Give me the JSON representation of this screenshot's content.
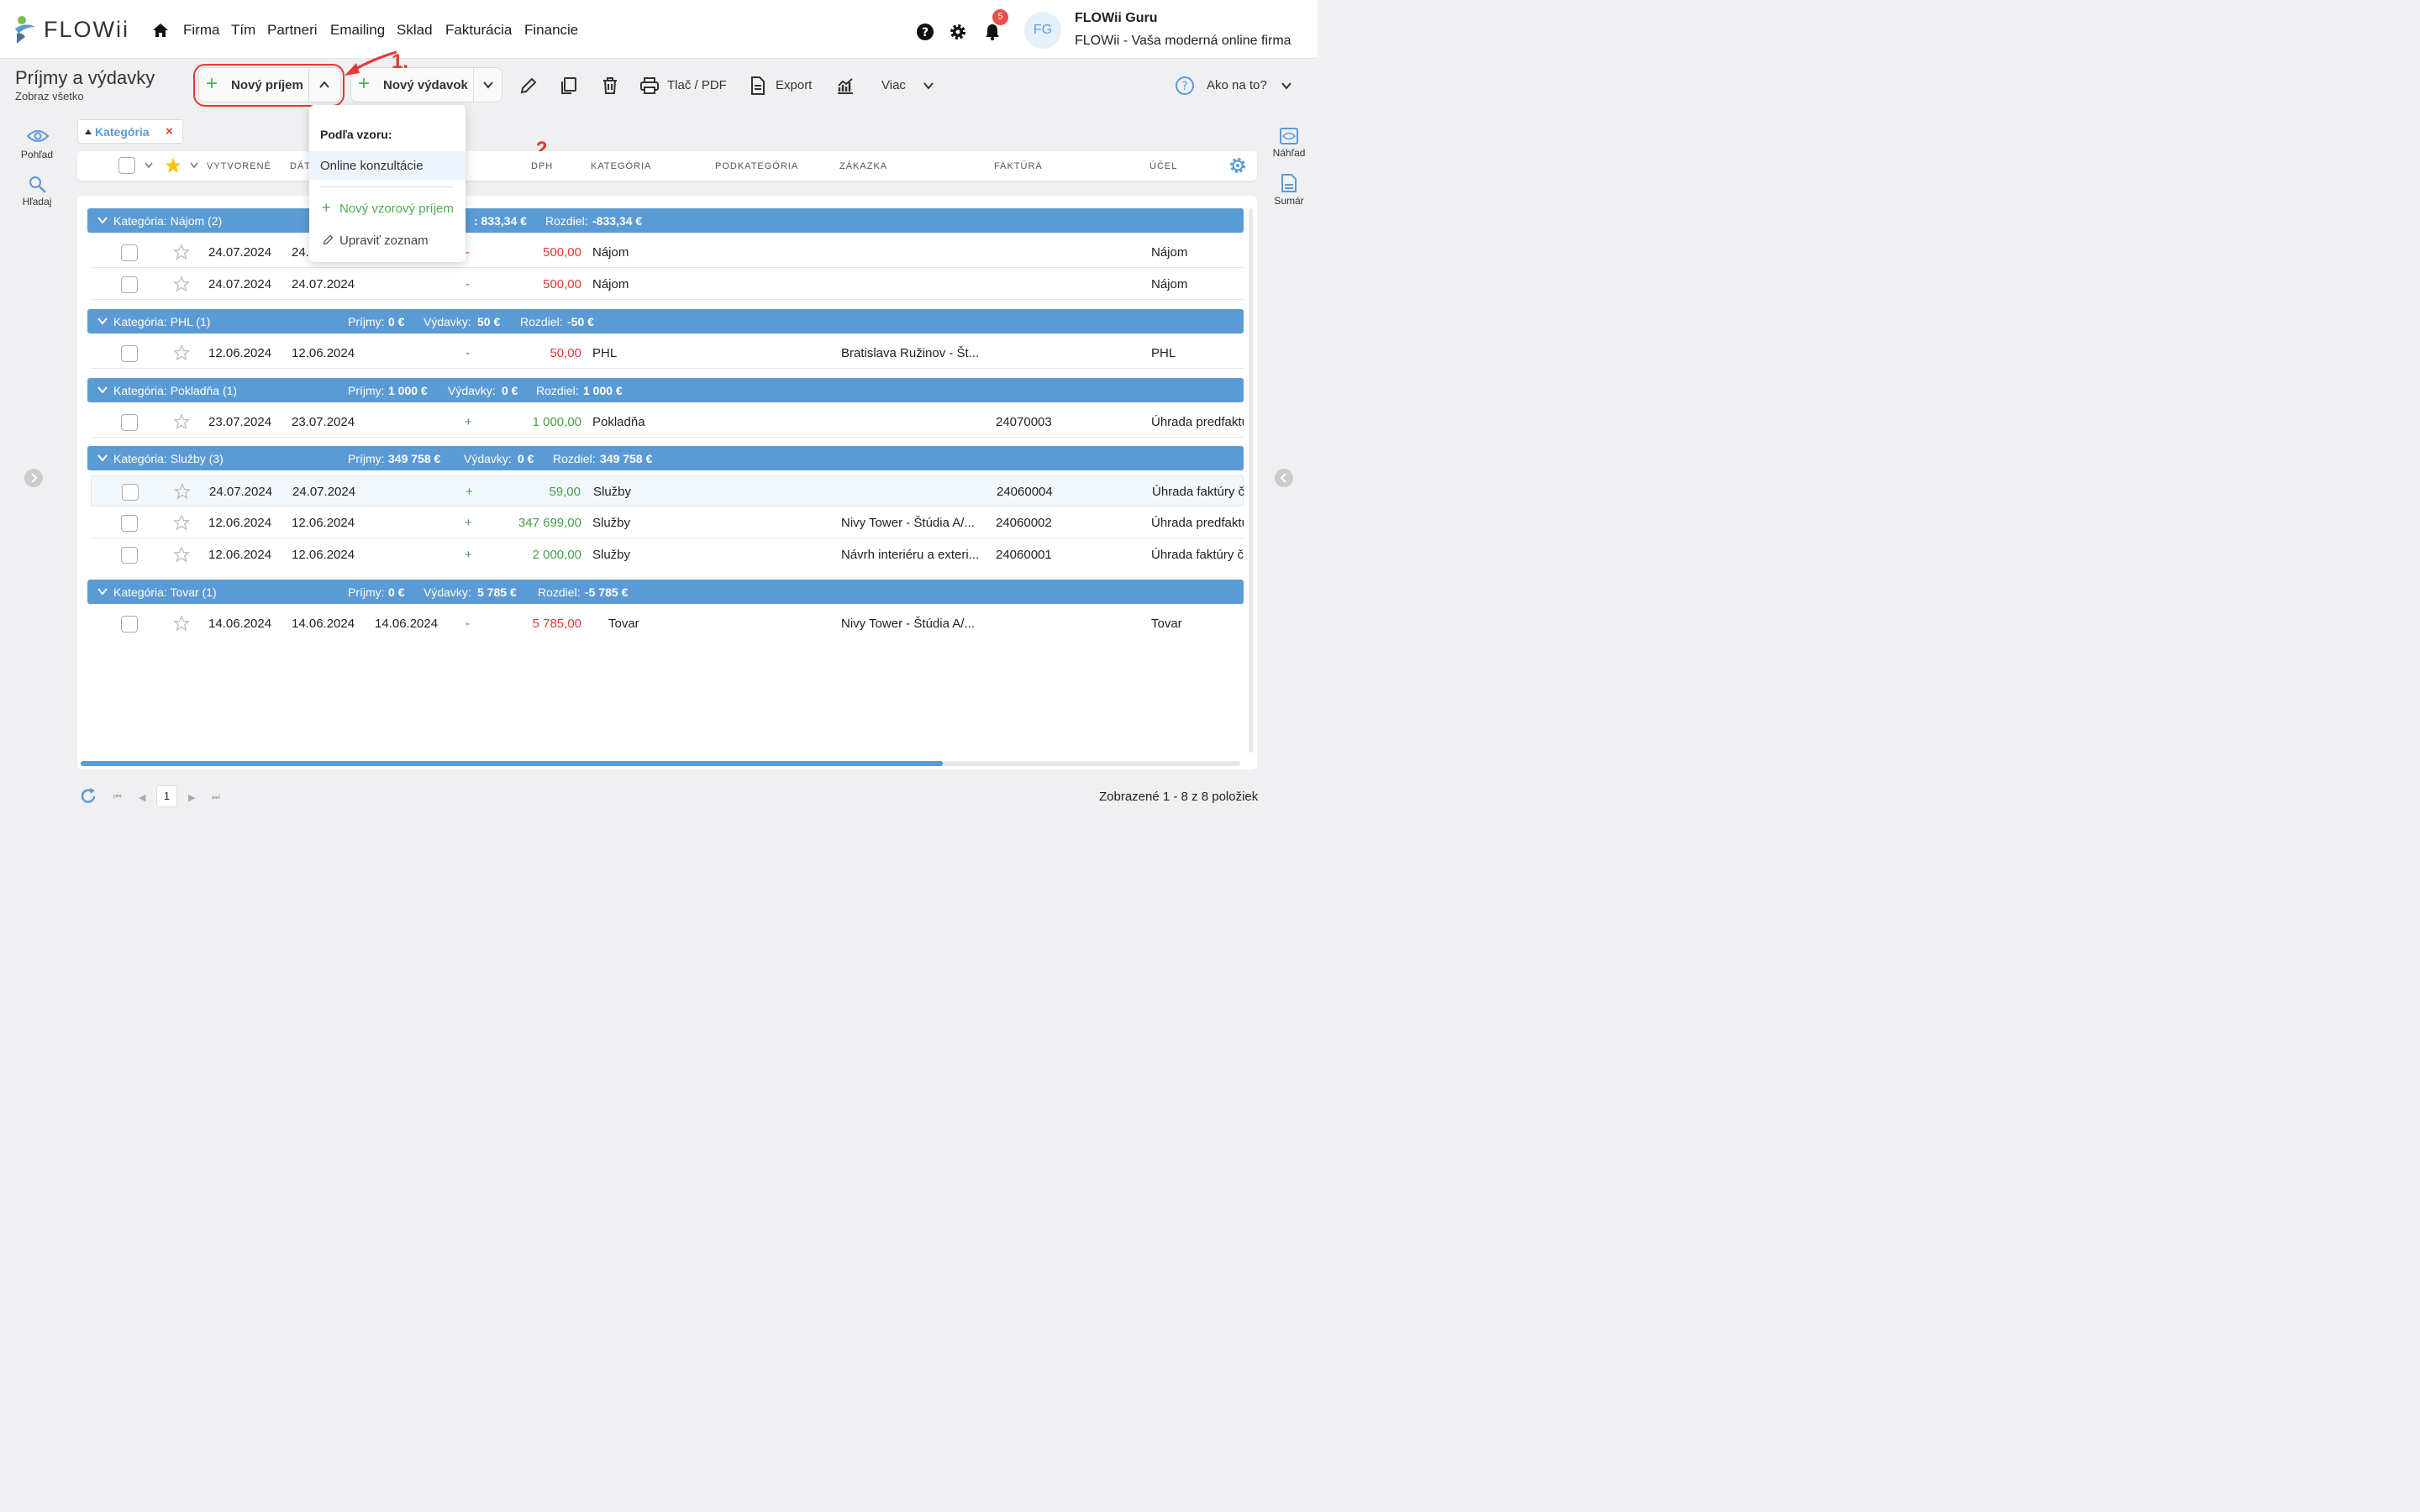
{
  "brand": {
    "name": "FLOWii"
  },
  "nav": [
    "Firma",
    "Tím",
    "Partneri",
    "Emailing",
    "Sklad",
    "Fakturácia",
    "Financie"
  ],
  "header": {
    "notifications": "5",
    "avatar": "FG",
    "user_name": "FLOWii Guru",
    "user_firm": "FLOWii - Vaša moderná online firma"
  },
  "page": {
    "title": "Príjmy a výdavky",
    "subtitle": "Zobraz všetko"
  },
  "toolbar": {
    "new_income": "Nový príjem",
    "new_expense": "Nový výdavok",
    "print": "Tlač / PDF",
    "export": "Export",
    "more": "Viac",
    "help": "Ako na to?"
  },
  "annotations": {
    "step1": "1.",
    "step2": "2."
  },
  "left_side": {
    "view": "Pohľad",
    "search": "Hľadaj"
  },
  "right_side": {
    "preview": "Náhľad",
    "summary": "Sumár"
  },
  "filter_chip": {
    "label": "Kategória",
    "remove": "×"
  },
  "columns": {
    "created": "VYTVORENÉ",
    "date": "DÁT",
    "dph": "DPH",
    "category": "KATEGÓRIA",
    "subcategory": "PODKATEGÓRIA",
    "order": "ZÁKAZKA",
    "invoice": "FAKTÚRA",
    "purpose": "ÚČEL"
  },
  "dropdown": {
    "heading": "Podľa vzoru:",
    "item": "Online konzultácie",
    "new_template": "Nový vzorový príjem",
    "edit_list": "Upraviť zoznam"
  },
  "groups": [
    {
      "title": "Kategória: Nájom (2)",
      "income_label": "",
      "income": "",
      "expense_label": "",
      "expense": ": 833,34 €",
      "diff_label": "Rozdiel:",
      "diff": "-833,34 €",
      "rows": [
        {
          "d1": "24.07.2024",
          "d2": "24.",
          "d3": "",
          "sign": "-",
          "amount": "500,00",
          "cat": "Nájom",
          "order": "",
          "invoice": "",
          "purpose": "Nájom"
        },
        {
          "d1": "24.07.2024",
          "d2": "24.07.2024",
          "d3": "",
          "sign": "-",
          "amount": "500,00",
          "cat": "Nájom",
          "order": "",
          "invoice": "",
          "purpose": "Nájom"
        }
      ]
    },
    {
      "title": "Kategória: PHL (1)",
      "income_label": "Príjmy:",
      "income": "0 €",
      "expense_label": "Výdavky:",
      "expense": "50 €",
      "diff_label": "Rozdiel:",
      "diff": "-50 €",
      "rows": [
        {
          "d1": "12.06.2024",
          "d2": "12.06.2024",
          "d3": "",
          "sign": "-",
          "amount": "50,00",
          "cat": "PHL",
          "order": "Bratislava Ružinov - Št...",
          "invoice": "",
          "purpose": "PHL"
        }
      ]
    },
    {
      "title": "Kategória: Pokladňa (1)",
      "income_label": "Príjmy:",
      "income": "1 000 €",
      "expense_label": "Výdavky:",
      "expense": "0 €",
      "diff_label": "Rozdiel:",
      "diff": "1 000 €",
      "rows": [
        {
          "d1": "23.07.2024",
          "d2": "23.07.2024",
          "d3": "",
          "sign": "+",
          "amount": "1 000,00",
          "cat": "Pokladňa",
          "order": "",
          "invoice": "24070003",
          "purpose": "Úhrada predfaktú"
        }
      ]
    },
    {
      "title": "Kategória: Služby (3)",
      "income_label": "Príjmy:",
      "income": "349 758 €",
      "expense_label": "Výdavky:",
      "expense": "0 €",
      "diff_label": "Rozdiel:",
      "diff": "349 758 €",
      "rows": [
        {
          "d1": "24.07.2024",
          "d2": "24.07.2024",
          "d3": "",
          "sign": "+",
          "amount": "59,00",
          "cat": "Služby",
          "order": "",
          "invoice": "24060004",
          "purpose": "Úhrada faktúry č"
        },
        {
          "d1": "12.06.2024",
          "d2": "12.06.2024",
          "d3": "",
          "sign": "+",
          "amount": "347 699,00",
          "cat": "Služby",
          "order": "Nivy Tower - Štúdia A/...",
          "invoice": "24060002",
          "purpose": "Úhrada predfaktú"
        },
        {
          "d1": "12.06.2024",
          "d2": "12.06.2024",
          "d3": "",
          "sign": "+",
          "amount": "2 000,00",
          "cat": "Služby",
          "order": "Návrh interiéru a exteri...",
          "invoice": "24060001",
          "purpose": "Úhrada faktúry č"
        }
      ]
    },
    {
      "title": "Kategória: Tovar (1)",
      "income_label": "Príjmy:",
      "income": "0 €",
      "expense_label": "Výdavky:",
      "expense": "5 785 €",
      "diff_label": "Rozdiel:",
      "diff": "-5 785 €",
      "rows": [
        {
          "d1": "14.06.2024",
          "d2": "14.06.2024",
          "d3": "14.06.2024",
          "sign": "-",
          "amount": "5 785,00",
          "cat": "Tovar",
          "order": "Nivy Tower - Štúdia A/...",
          "invoice": "",
          "purpose": "Tovar"
        }
      ]
    }
  ],
  "pagination": {
    "page": "1",
    "summary": "Zobrazené 1 - 8 z 8 položiek"
  },
  "colors": {
    "accent": "#5b9bd5",
    "income": "#43a047",
    "expense": "#e53935",
    "annotation": "#e53935"
  }
}
